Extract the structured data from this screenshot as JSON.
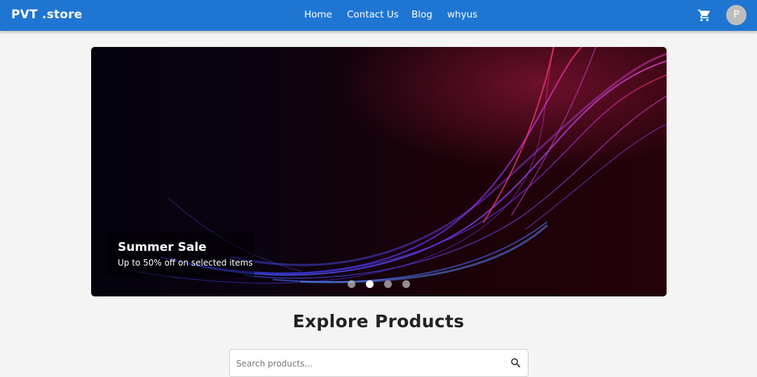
{
  "brand": "PVT .store",
  "nav": [
    {
      "label": "Home"
    },
    {
      "label": "Contact Us"
    },
    {
      "label": "Blog"
    },
    {
      "label": "whyus"
    }
  ],
  "header_icons": {
    "cart": "shopping-cart-icon"
  },
  "avatar": {
    "initial": "P"
  },
  "hero": {
    "title": "Summer Sale",
    "subtitle": "Up to 50% off on selected items",
    "slide_count": 4,
    "active_slide": 2
  },
  "section": {
    "title": "Explore Products"
  },
  "search": {
    "placeholder": "Search products...",
    "value": "",
    "icon": "search-icon"
  },
  "colors": {
    "appbar": "#1f76d2",
    "background": "#f4f4f4",
    "avatar": "#bdbdbd"
  }
}
